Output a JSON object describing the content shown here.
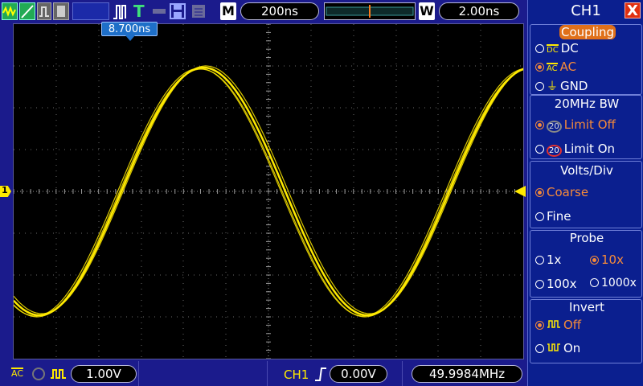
{
  "top_bar": {
    "trigger_status": "T",
    "time_scale": "200ns",
    "window_badge": "W",
    "window_time": "2.00ns",
    "menu_badge": "M"
  },
  "screen": {
    "trigger_position_label": "8.700ns",
    "channel_marker": "1",
    "trace_color": "#ffea00"
  },
  "bottom_bar": {
    "coupling_glyph": "AC",
    "volts_per_div": "1.00V",
    "trigger_source": "CH1",
    "trigger_level": "0.00V",
    "frequency": "49.9984MHz"
  },
  "menu": {
    "title": "CH1",
    "close_symbol": "X",
    "coupling": {
      "title": "Coupling",
      "options": [
        {
          "label": "DC",
          "glyph": "DC",
          "selected": false
        },
        {
          "label": "AC",
          "glyph": "AC",
          "selected": true
        },
        {
          "label": "GND",
          "glyph": "⏚",
          "selected": false
        }
      ]
    },
    "bw_limit": {
      "title": "20MHz BW",
      "options": [
        {
          "label": "Limit Off",
          "glyph": "20",
          "selected": true
        },
        {
          "label": "Limit On",
          "glyph": "20",
          "selected": false
        }
      ]
    },
    "volts_div": {
      "title": "Volts/Div",
      "options": [
        {
          "label": "Coarse",
          "selected": true
        },
        {
          "label": "Fine",
          "selected": false
        }
      ]
    },
    "probe": {
      "title": "Probe",
      "options": [
        {
          "label": "1x",
          "selected": false
        },
        {
          "label": "10x",
          "selected": true
        },
        {
          "label": "100x",
          "selected": false
        },
        {
          "label": "1000x",
          "selected": false
        }
      ]
    },
    "invert": {
      "title": "Invert",
      "options": [
        {
          "label": "Off",
          "selected": true
        },
        {
          "label": "On",
          "selected": false
        }
      ]
    }
  }
}
